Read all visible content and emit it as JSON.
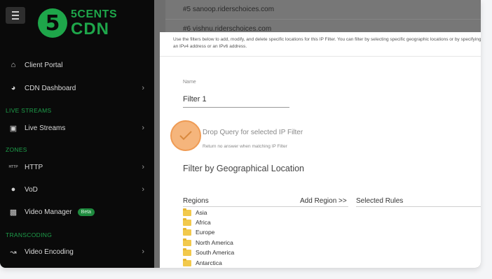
{
  "brand": {
    "number": "5",
    "line1": "5CENTS",
    "line2": "CDN"
  },
  "sidebar": {
    "items": [
      {
        "label": "Client Portal",
        "icon": "home-icon"
      },
      {
        "label": "CDN Dashboard",
        "icon": "gauge-icon"
      },
      {
        "label": "Live Streams",
        "icon": "tv-icon"
      },
      {
        "label": "HTTP",
        "icon": "http-icon",
        "icon_text": "HTTP"
      },
      {
        "label": "VoD",
        "icon": "play-circle-icon"
      },
      {
        "label": "Video Manager",
        "icon": "video-icon",
        "badge": "Beta"
      },
      {
        "label": "Video Encoding",
        "icon": "encoding-icon"
      }
    ],
    "sections": {
      "live": "LIVE STREAMS",
      "zones": "ZONES",
      "transcoding": "TRANSCODING"
    }
  },
  "background_list": {
    "row1": "#5 sanoop.riderschoices.com",
    "row2": "#6 vishnu.riderschoices.com"
  },
  "modal": {
    "intro": "Use the filters below to add, modify, and delete specific locations for this IP Filter. You can filter by selecting specific geographic locations or by specifying an IPv4 address or an IPv6 address.",
    "name_label": "Name",
    "name_value": "Filter 1",
    "checkbox_label": "Drop Query for selected IP Filter",
    "checkbox_help": "Return no answer when matching IP Filter",
    "geo_title": "Filter by Geographical Location",
    "regions_header": "Regions",
    "add_region": "Add Region >>",
    "selected_rules_header": "Selected Rules",
    "regions": [
      "Asia",
      "Africa",
      "Europe",
      "North America",
      "South America",
      "Antarctica"
    ]
  },
  "colors": {
    "brand_green": "#1ea64a",
    "checkbox_orange": "#f5b57c",
    "folder_yellow": "#f2c94c"
  }
}
